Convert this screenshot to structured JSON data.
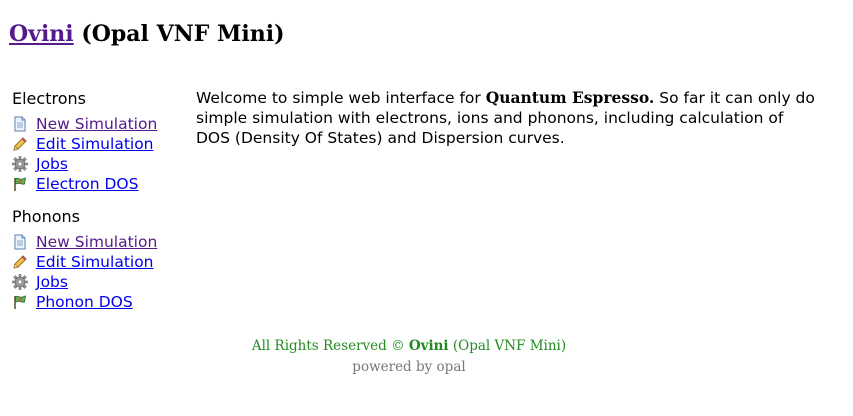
{
  "header": {
    "app_link": "Ovini",
    "subtitle": "(Opal VNF Mini)"
  },
  "sidebar": {
    "electrons": {
      "title": "Electrons",
      "items": [
        {
          "label": "New Simulation",
          "icon": "document-icon"
        },
        {
          "label": "Edit Simulation",
          "icon": "pencil-icon"
        },
        {
          "label": "Jobs",
          "icon": "gear-icon"
        },
        {
          "label": "Electron DOS",
          "icon": "flag-icon"
        }
      ]
    },
    "phonons": {
      "title": "Phonons",
      "items": [
        {
          "label": "New Simulation",
          "icon": "document-icon"
        },
        {
          "label": "Edit Simulation",
          "icon": "pencil-icon"
        },
        {
          "label": "Jobs",
          "icon": "gear-icon"
        },
        {
          "label": "Phonon DOS",
          "icon": "flag-icon"
        }
      ]
    }
  },
  "main": {
    "intro_before": "Welcome to simple web interface for ",
    "intro_bold": "Quantum Espresso.",
    "intro_after": " So far it can only do simple simulation with electrons, ions and phonons, including calculation of DOS (Density Of States) and Dispersion curves."
  },
  "footer": {
    "rights_prefix": "All Rights Reserved © ",
    "rights_brand": "Ovini",
    "rights_suffix": " (Opal VNF Mini)",
    "powered": "powered by opal"
  },
  "colors": {
    "link": "#0000ee",
    "visited_link": "#551a8b",
    "footer_green": "#228b22",
    "footer_gray": "#777777"
  }
}
